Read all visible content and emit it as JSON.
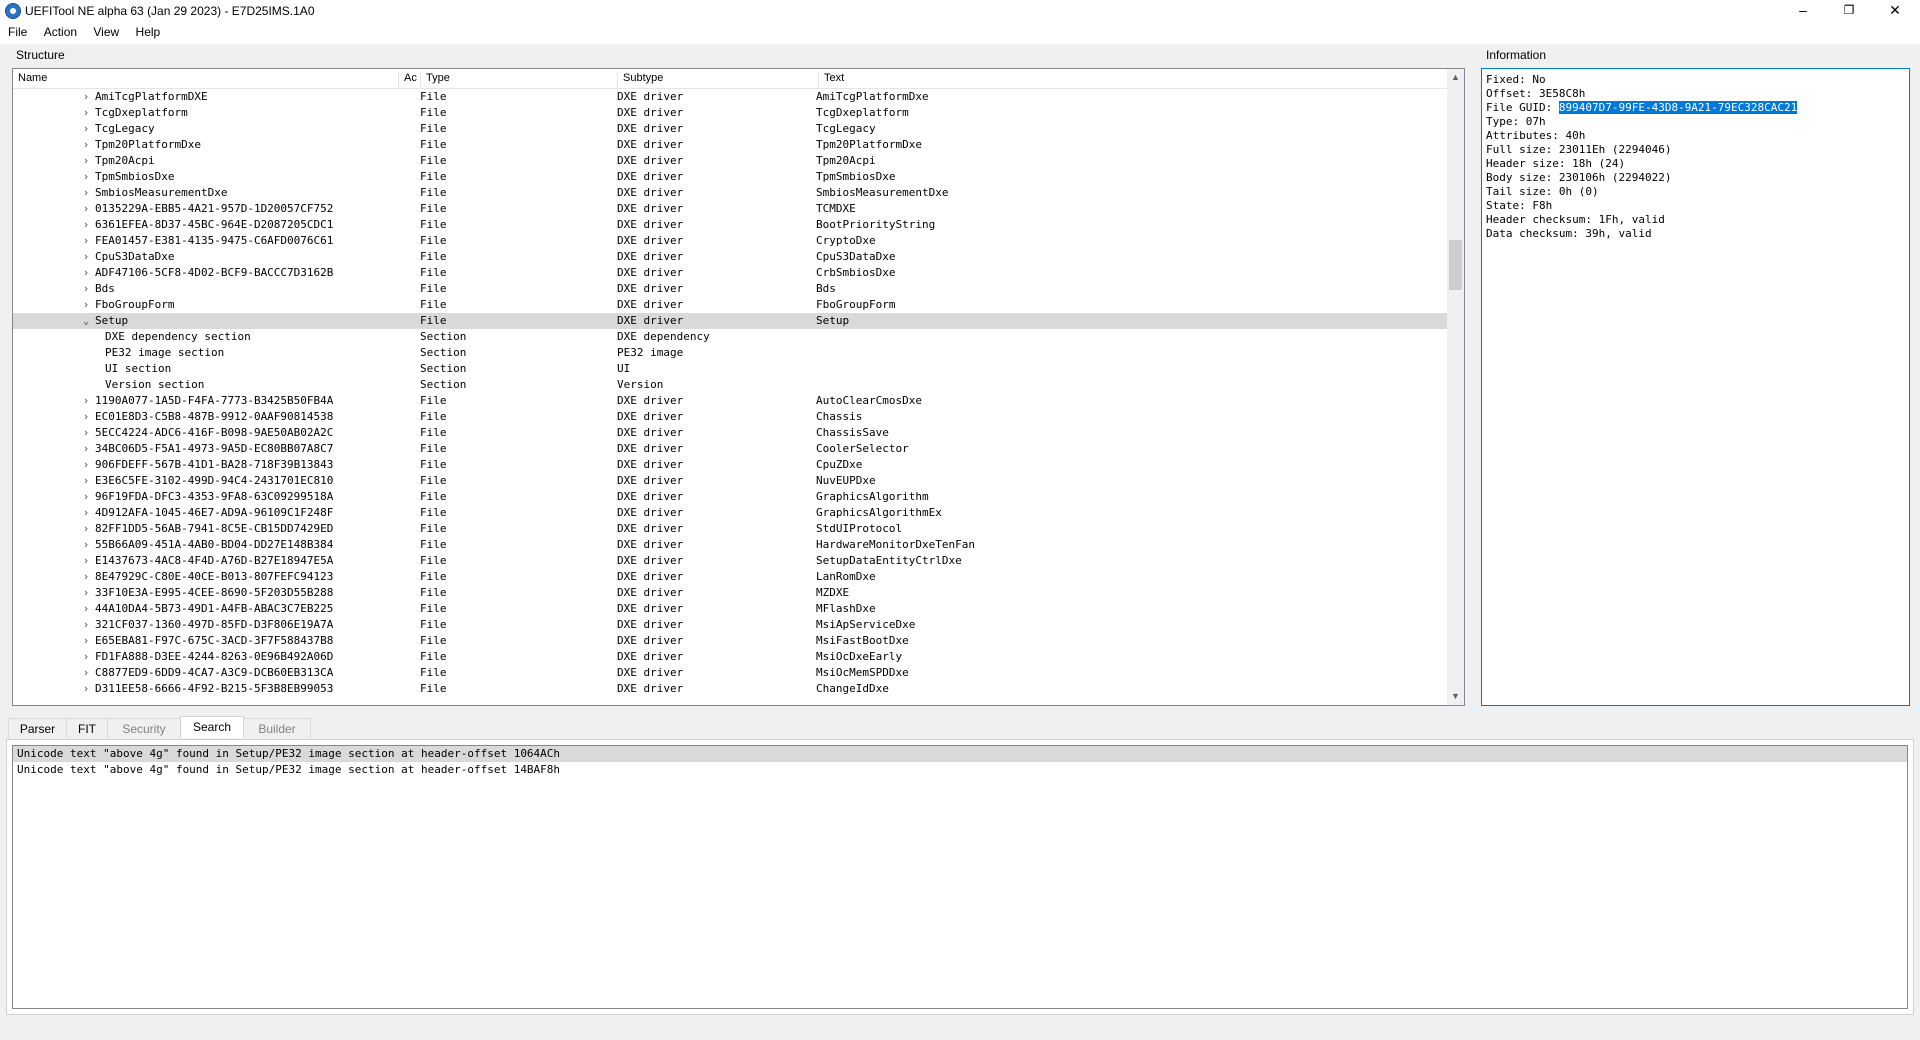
{
  "window": {
    "title": "UEFITool NE alpha 63 (Jan 29 2023) - E7D25IMS.1A0"
  },
  "menu": [
    {
      "label": "File"
    },
    {
      "label": "Action"
    },
    {
      "label": "View"
    },
    {
      "label": "Help"
    }
  ],
  "structure": {
    "group_label": "Structure",
    "columns": {
      "name": "Name",
      "action": "Ac",
      "type": "Type",
      "subtype": "Subtype",
      "text": "Text"
    },
    "rows": [
      {
        "expander": "›",
        "indent": 0,
        "name": "AmiTcgPlatformDXE",
        "type": "File",
        "subtype": "DXE driver",
        "text": "AmiTcgPlatformDxe"
      },
      {
        "expander": "›",
        "indent": 0,
        "name": "TcgDxeplatform",
        "type": "File",
        "subtype": "DXE driver",
        "text": "TcgDxeplatform"
      },
      {
        "expander": "›",
        "indent": 0,
        "name": "TcgLegacy",
        "type": "File",
        "subtype": "DXE driver",
        "text": "TcgLegacy"
      },
      {
        "expander": "›",
        "indent": 0,
        "name": "Tpm20PlatformDxe",
        "type": "File",
        "subtype": "DXE driver",
        "text": "Tpm20PlatformDxe"
      },
      {
        "expander": "›",
        "indent": 0,
        "name": "Tpm20Acpi",
        "type": "File",
        "subtype": "DXE driver",
        "text": "Tpm20Acpi"
      },
      {
        "expander": "›",
        "indent": 0,
        "name": "TpmSmbiosDxe",
        "type": "File",
        "subtype": "DXE driver",
        "text": "TpmSmbiosDxe"
      },
      {
        "expander": "›",
        "indent": 0,
        "name": "SmbiosMeasurementDxe",
        "type": "File",
        "subtype": "DXE driver",
        "text": "SmbiosMeasurementDxe"
      },
      {
        "expander": "›",
        "indent": 0,
        "name": "0135229A-EBB5-4A21-957D-1D20057CF752",
        "type": "File",
        "subtype": "DXE driver",
        "text": "TCMDXE"
      },
      {
        "expander": "›",
        "indent": 0,
        "name": "6361EFEA-8D37-45BC-964E-D2087205CDC1",
        "type": "File",
        "subtype": "DXE driver",
        "text": "BootPriorityString"
      },
      {
        "expander": "›",
        "indent": 0,
        "name": "FEA01457-E381-4135-9475-C6AFD0076C61",
        "type": "File",
        "subtype": "DXE driver",
        "text": "CryptoDxe"
      },
      {
        "expander": "›",
        "indent": 0,
        "name": "CpuS3DataDxe",
        "type": "File",
        "subtype": "DXE driver",
        "text": "CpuS3DataDxe"
      },
      {
        "expander": "›",
        "indent": 0,
        "name": "ADF47106-5CF8-4D02-BCF9-BACCC7D3162B",
        "type": "File",
        "subtype": "DXE driver",
        "text": "CrbSmbiosDxe"
      },
      {
        "expander": "›",
        "indent": 0,
        "name": "Bds",
        "type": "File",
        "subtype": "DXE driver",
        "text": "Bds"
      },
      {
        "expander": "›",
        "indent": 0,
        "name": "FboGroupForm",
        "type": "File",
        "subtype": "DXE driver",
        "text": "FboGroupForm"
      },
      {
        "expander": "⌄",
        "indent": 0,
        "name": "Setup",
        "type": "File",
        "subtype": "DXE driver",
        "text": "Setup",
        "selected": true
      },
      {
        "expander": "",
        "indent": 1,
        "name": "DXE dependency section",
        "type": "Section",
        "subtype": "DXE dependency",
        "text": ""
      },
      {
        "expander": "",
        "indent": 1,
        "name": "PE32 image section",
        "type": "Section",
        "subtype": "PE32 image",
        "text": ""
      },
      {
        "expander": "",
        "indent": 1,
        "name": "UI section",
        "type": "Section",
        "subtype": "UI",
        "text": ""
      },
      {
        "expander": "",
        "indent": 1,
        "name": "Version section",
        "type": "Section",
        "subtype": "Version",
        "text": ""
      },
      {
        "expander": "›",
        "indent": 0,
        "name": "1190A077-1A5D-F4FA-7773-B3425B50FB4A",
        "type": "File",
        "subtype": "DXE driver",
        "text": "AutoClearCmosDxe"
      },
      {
        "expander": "›",
        "indent": 0,
        "name": "EC01E8D3-C5B8-487B-9912-0AAF90814538",
        "type": "File",
        "subtype": "DXE driver",
        "text": "Chassis"
      },
      {
        "expander": "›",
        "indent": 0,
        "name": "5ECC4224-ADC6-416F-B098-9AE50AB02A2C",
        "type": "File",
        "subtype": "DXE driver",
        "text": "ChassisSave"
      },
      {
        "expander": "›",
        "indent": 0,
        "name": "34BC06D5-F5A1-4973-9A5D-EC80BB07A8C7",
        "type": "File",
        "subtype": "DXE driver",
        "text": "CoolerSelector"
      },
      {
        "expander": "›",
        "indent": 0,
        "name": "906FDEFF-567B-41D1-BA28-718F39B13843",
        "type": "File",
        "subtype": "DXE driver",
        "text": "CpuZDxe"
      },
      {
        "expander": "›",
        "indent": 0,
        "name": "E3E6C5FE-3102-499D-94C4-2431701EC810",
        "type": "File",
        "subtype": "DXE driver",
        "text": "NuvEUPDxe"
      },
      {
        "expander": "›",
        "indent": 0,
        "name": "96F19FDA-DFC3-4353-9FA8-63C09299518A",
        "type": "File",
        "subtype": "DXE driver",
        "text": "GraphicsAlgorithm"
      },
      {
        "expander": "›",
        "indent": 0,
        "name": "4D912AFA-1045-46E7-AD9A-96109C1F248F",
        "type": "File",
        "subtype": "DXE driver",
        "text": "GraphicsAlgorithmEx"
      },
      {
        "expander": "›",
        "indent": 0,
        "name": "82FF1DD5-56AB-7941-8C5E-CB15DD7429ED",
        "type": "File",
        "subtype": "DXE driver",
        "text": "StdUIProtocol"
      },
      {
        "expander": "›",
        "indent": 0,
        "name": "55B66A09-451A-4AB0-BD04-DD27E148B384",
        "type": "File",
        "subtype": "DXE driver",
        "text": "HardwareMonitorDxeTenFan"
      },
      {
        "expander": "›",
        "indent": 0,
        "name": "E1437673-4AC8-4F4D-A76D-B27E18947E5A",
        "type": "File",
        "subtype": "DXE driver",
        "text": "SetupDataEntityCtrlDxe"
      },
      {
        "expander": "›",
        "indent": 0,
        "name": "8E47929C-C80E-40CE-B013-807FEFC94123",
        "type": "File",
        "subtype": "DXE driver",
        "text": "LanRomDxe"
      },
      {
        "expander": "›",
        "indent": 0,
        "name": "33F10E3A-E995-4CEE-8690-5F203D55B288",
        "type": "File",
        "subtype": "DXE driver",
        "text": "MZDXE"
      },
      {
        "expander": "›",
        "indent": 0,
        "name": "44A10DA4-5B73-49D1-A4FB-ABAC3C7EB225",
        "type": "File",
        "subtype": "DXE driver",
        "text": "MFlashDxe"
      },
      {
        "expander": "›",
        "indent": 0,
        "name": "321CF037-1360-497D-85FD-D3F806E19A7A",
        "type": "File",
        "subtype": "DXE driver",
        "text": "MsiApServiceDxe"
      },
      {
        "expander": "›",
        "indent": 0,
        "name": "E65EBA81-F97C-675C-3ACD-3F7F588437B8",
        "type": "File",
        "subtype": "DXE driver",
        "text": "MsiFastBootDxe"
      },
      {
        "expander": "›",
        "indent": 0,
        "name": "FD1FA888-D3EE-4244-8263-0E96B492A06D",
        "type": "File",
        "subtype": "DXE driver",
        "text": "MsiOcDxeEarly"
      },
      {
        "expander": "›",
        "indent": 0,
        "name": "C8877ED9-6DD9-4CA7-A3C9-DCB60EB313CA",
        "type": "File",
        "subtype": "DXE driver",
        "text": "MsiOcMemSPDDxe"
      },
      {
        "expander": "›",
        "indent": 0,
        "name": "D311EE58-6666-4F92-B215-5F3B8EB99053",
        "type": "File",
        "subtype": "DXE driver",
        "text": "ChangeIdDxe"
      }
    ],
    "scroll_position": 0.28
  },
  "information": {
    "group_label": "Information",
    "lines": [
      {
        "label": "Fixed: ",
        "value": "No"
      },
      {
        "label": "Offset: ",
        "value": "3E58C8h"
      },
      {
        "label": "File GUID: ",
        "value": "899407D7-99FE-43D8-9A21-79EC328CAC21",
        "highlighted": true
      },
      {
        "label": "Type: ",
        "value": "07h"
      },
      {
        "label": "Attributes: ",
        "value": "40h"
      },
      {
        "label": "Full size: ",
        "value": "23011Eh (2294046)"
      },
      {
        "label": "Header size: ",
        "value": "18h (24)"
      },
      {
        "label": "Body size: ",
        "value": "230106h (2294022)"
      },
      {
        "label": "Tail size: ",
        "value": "0h (0)"
      },
      {
        "label": "State: ",
        "value": "F8h"
      },
      {
        "label": "Header checksum: ",
        "value": "1Fh, valid"
      },
      {
        "label": "Data checksum: ",
        "value": "39h, valid"
      }
    ]
  },
  "tabs": [
    {
      "label": "Parser",
      "state": "normal"
    },
    {
      "label": "FIT",
      "state": "normal"
    },
    {
      "label": "Security",
      "state": "disabled"
    },
    {
      "label": "Search",
      "state": "active"
    },
    {
      "label": "Builder",
      "state": "disabled"
    }
  ],
  "search_results": [
    {
      "text": "Unicode text \"above 4g\" found in Setup/PE32 image section at header-offset 1064ACh",
      "selected": true
    },
    {
      "text": "Unicode text \"above 4g\" found in Setup/PE32 image section at header-offset 14BAF8h",
      "selected": false
    }
  ]
}
